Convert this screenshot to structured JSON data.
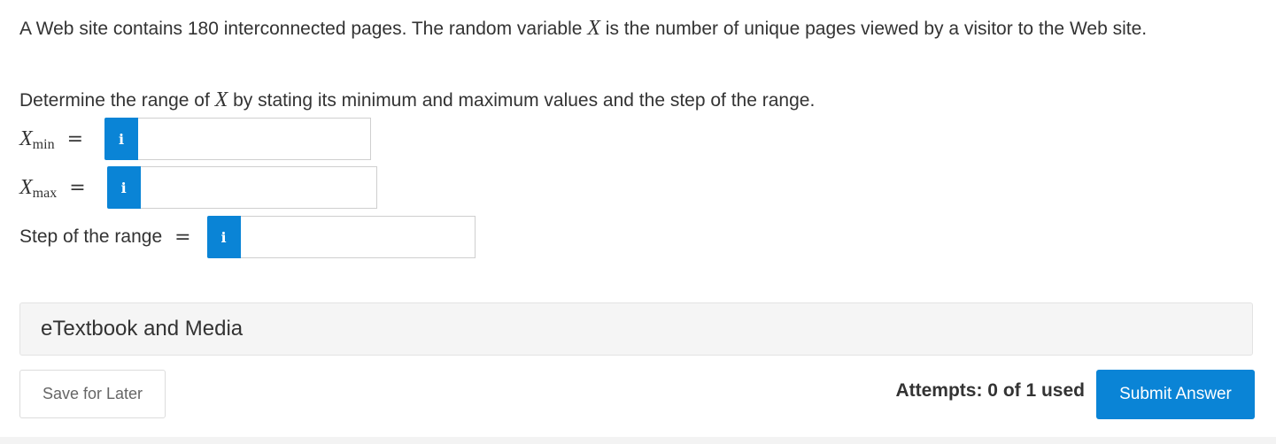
{
  "question": {
    "text_before_var": "A Web site contains 180 interconnected pages. The random variable ",
    "var": "X",
    "text_after_var": " is the number of unique pages viewed by a visitor to the Web site."
  },
  "instruction": {
    "before": "Determine the range of ",
    "var": "X",
    "after": " by stating its minimum and maximum values and the step of the range."
  },
  "fields": {
    "xmin": {
      "var": "X",
      "sub": "min",
      "eq": "=",
      "info_icon": "i",
      "value": ""
    },
    "xmax": {
      "var": "X",
      "sub": "max",
      "eq": "=",
      "info_icon": "i",
      "value": ""
    },
    "step": {
      "label": "Step of the range",
      "eq": "=",
      "info_icon": "i",
      "value": ""
    }
  },
  "media": {
    "label": "eTextbook and Media"
  },
  "footer": {
    "save_label": "Save for Later",
    "attempts": "Attempts: 0 of 1 used",
    "submit_label": "Submit Answer"
  },
  "colors": {
    "accent": "#0a84d6",
    "text": "#333333",
    "panel": "#f5f5f5"
  }
}
